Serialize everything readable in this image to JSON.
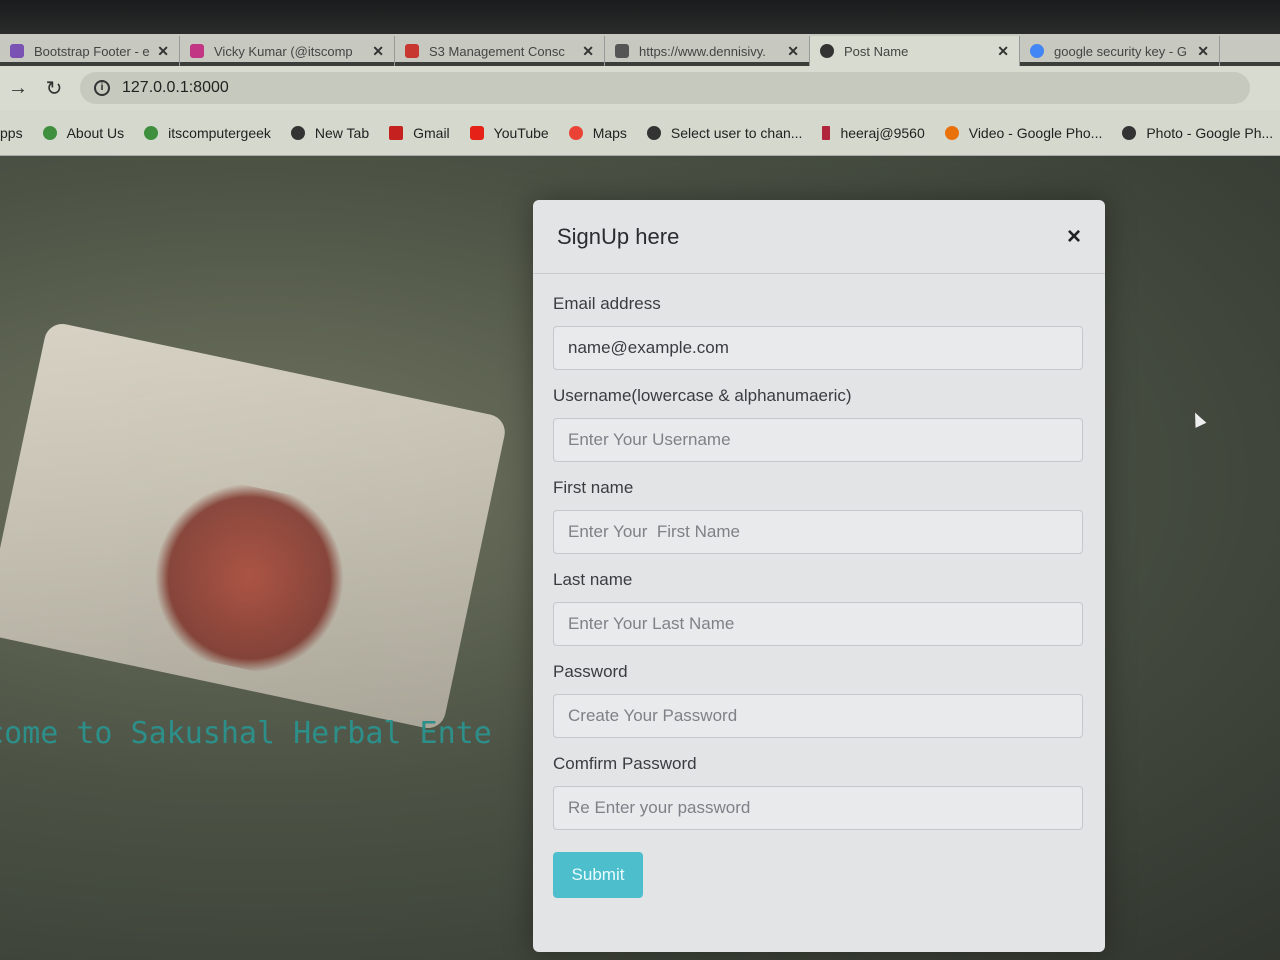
{
  "browser": {
    "tabs": [
      {
        "title": "Bootstrap Footer - exar",
        "favicon_color": "#7952b3"
      },
      {
        "title": "Vicky Kumar (@itscomp",
        "favicon_color": "#c13584"
      },
      {
        "title": "S3 Management Consc",
        "favicon_color": "#c7372f"
      },
      {
        "title": "https://www.dennisivy.",
        "favicon_color": "#555555"
      },
      {
        "title": "Post Name",
        "favicon_color": "#333333"
      },
      {
        "title": "google security key - G",
        "favicon_color": "#4285f4"
      }
    ],
    "address": "127.0.0.1:8000",
    "bookmarks": [
      {
        "label": "pps",
        "icon": "apps-icon",
        "color": "#777777"
      },
      {
        "label": "About Us",
        "icon": "person-icon",
        "color": "#3f8f3f"
      },
      {
        "label": "itscomputergeek",
        "icon": "person-icon",
        "color": "#3f8f3f"
      },
      {
        "label": "New Tab",
        "icon": "globe-icon",
        "color": "#333333"
      },
      {
        "label": "Gmail",
        "icon": "gmail-icon",
        "color": "#c5221f"
      },
      {
        "label": "YouTube",
        "icon": "youtube-icon",
        "color": "#e62117"
      },
      {
        "label": "Maps",
        "icon": "maps-pin-icon",
        "color": "#ea4335"
      },
      {
        "label": "Select user to chan...",
        "icon": "globe-icon",
        "color": "#333333"
      },
      {
        "label": "heeraj@9560",
        "icon": "bookmark-icon",
        "color": "#b0243c"
      },
      {
        "label": "Video - Google Pho...",
        "icon": "pinwheel-icon",
        "color": "#e8710a"
      },
      {
        "label": "Photo - Google Ph...",
        "icon": "globe-icon",
        "color": "#333333"
      }
    ]
  },
  "page": {
    "welcome_text": "lcome to Sakushal Herbal Ente"
  },
  "modal": {
    "title": "SignUp here",
    "close_label": "×",
    "fields": {
      "email": {
        "label": "Email address",
        "value": "name@example.com"
      },
      "username": {
        "label": "Username(lowercase & alphanumaeric)",
        "placeholder": "Enter Your Username"
      },
      "first_name": {
        "label": "First name",
        "placeholder": "Enter Your  First Name"
      },
      "last_name": {
        "label": "Last name",
        "placeholder": "Enter Your Last Name"
      },
      "password": {
        "label": "Password",
        "placeholder": "Create Your Password"
      },
      "confirm_password": {
        "label": "Comfirm Password",
        "placeholder": "Re Enter your password"
      }
    },
    "submit_label": "Submit"
  }
}
